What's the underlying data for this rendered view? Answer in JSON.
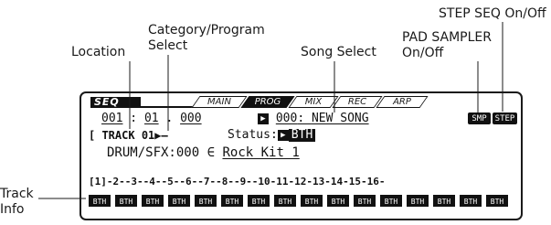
{
  "callouts": {
    "location": "Location",
    "category_program_line1": "Category/Program",
    "category_program_line2": "Select",
    "song_select": "Song Select",
    "pad_sampler_line1": "PAD SAMPLER",
    "pad_sampler_line2": "On/Off",
    "step_seq": "STEP SEQ On/Off",
    "track_info_line1": "Track",
    "track_info_line2": "Info"
  },
  "lcd": {
    "mode": "SEQ",
    "tabs": [
      "MAIN",
      "PROG",
      "MIX",
      "REC",
      "ARP"
    ],
    "active_tab": "PROG",
    "location": {
      "bar": "001",
      "beat": "01",
      "tick": "000"
    },
    "song_arrow": "▶",
    "song_number": "000",
    "song_name": "NEW SONG",
    "pad_sampler_button": "SMP",
    "step_seq_button": "STEP",
    "track_label": "TRACK",
    "track_number": "01",
    "track_arrow": "▶",
    "status_label": "Status:",
    "status_value": "BTH",
    "category": "DRUM/SFX:000",
    "program_name": "Rock Kit 1",
    "track_numbers": "[1]-2--3--4--5--6--7--8--9--10-11-12-13-14-15-16-",
    "track_status": [
      "BTH",
      "BTH",
      "BTH",
      "BTH",
      "BTH",
      "BTH",
      "BTH",
      "BTH",
      "BTH",
      "BTH",
      "BTH",
      "BTH",
      "BTH",
      "BTH",
      "BTH",
      "BTH"
    ]
  }
}
